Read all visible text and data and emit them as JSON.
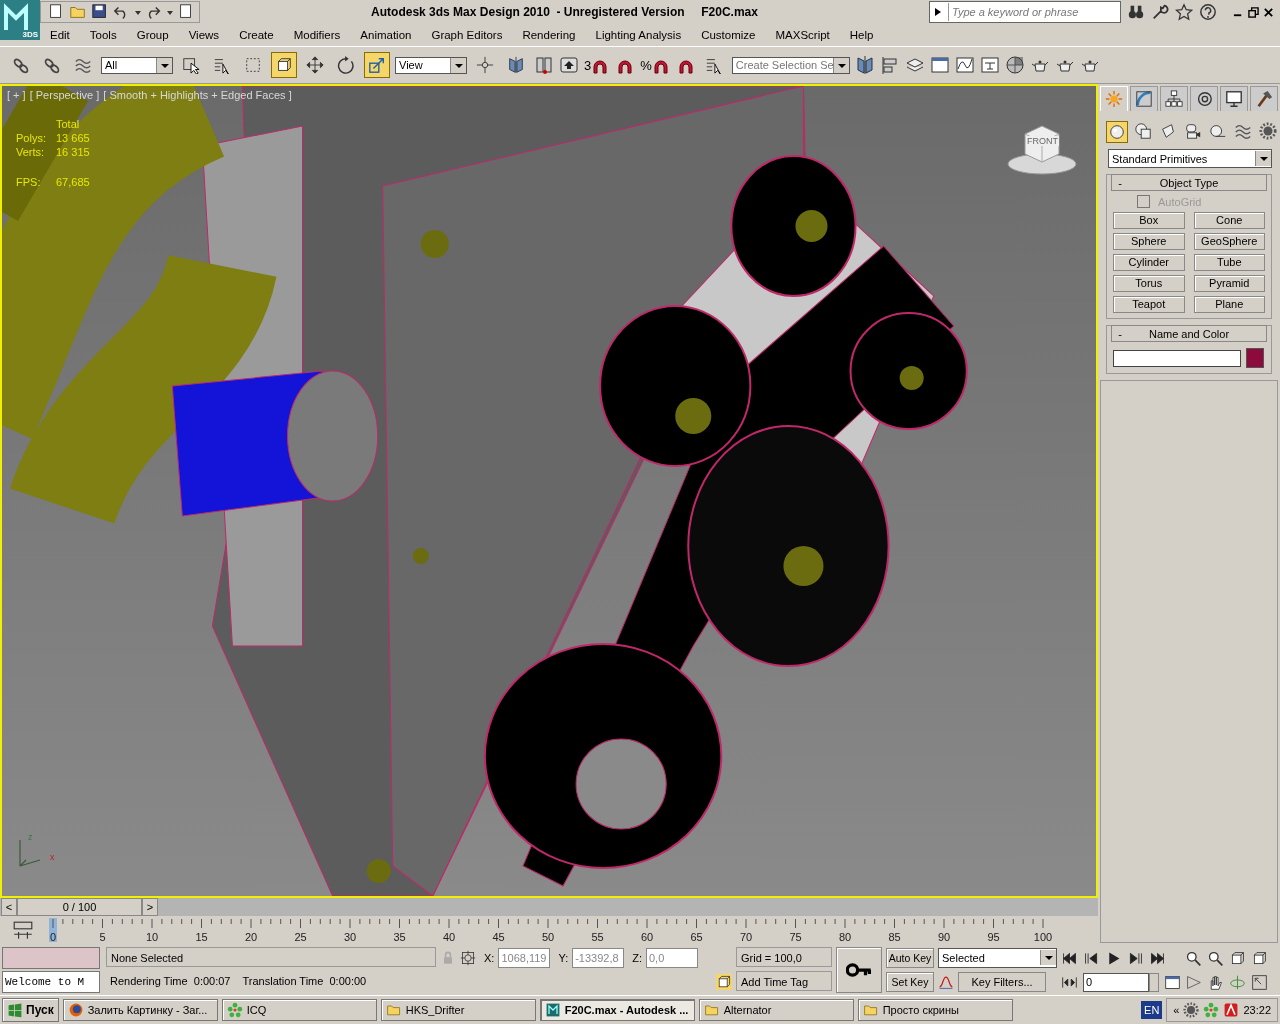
{
  "title_bar": {
    "logo_label": "3DS",
    "title": "Autodesk 3ds Max Design 2010  - Unregistered Version     F20C.max",
    "search_placeholder": "Type a keyword or phrase"
  },
  "menu": [
    "Edit",
    "Tools",
    "Group",
    "Views",
    "Create",
    "Modifiers",
    "Animation",
    "Graph Editors",
    "Rendering",
    "Lighting Analysis",
    "Customize",
    "MAXScript",
    "Help"
  ],
  "toolbar": {
    "selection_filter": "All",
    "reference_coordinate": "View",
    "snap_label": "3",
    "percent_label": "%",
    "named_selection_placeholder": "Create Selection Se",
    "tool_buttons": [
      {
        "selected": false
      },
      {
        "selected": false
      },
      {
        "selected": false
      },
      {
        "selected": true
      },
      {
        "selected": false
      },
      {
        "selected": false
      },
      {
        "selected": true
      },
      {
        "selected": false
      },
      {
        "selected": false
      },
      {
        "selected": false
      }
    ]
  },
  "viewport": {
    "active": true,
    "labels": [
      "[ + ]",
      "[ Perspective ]",
      "[ Smooth + Highlights + Edged Faces ]"
    ],
    "stats_header": "Total",
    "stats": [
      {
        "label": "Polys:",
        "value": "13 665"
      },
      {
        "label": "Verts:",
        "value": "16 315"
      }
    ],
    "fps": {
      "label": "FPS:",
      "value": "67,685"
    },
    "viewcube_label": "FRONT",
    "axis_labels": [
      "z",
      "x"
    ]
  },
  "command_panel": {
    "tabs": [
      {
        "selected": true
      },
      {
        "selected": false
      },
      {
        "selected": false
      },
      {
        "selected": false
      },
      {
        "selected": false
      },
      {
        "selected": false
      }
    ],
    "categories": [
      {
        "selected": true
      },
      {
        "selected": false
      },
      {
        "selected": false
      },
      {
        "selected": false
      },
      {
        "selected": false
      },
      {
        "selected": false
      },
      {
        "selected": false
      }
    ],
    "dropdown": "Standard Primitives",
    "object_type": {
      "collapse": "-",
      "title": "Object Type",
      "autogrid": {
        "label": "AutoGrid",
        "checked": false,
        "disabled": true
      },
      "buttons": [
        "Box",
        "Cone",
        "Sphere",
        "GeoSphere",
        "Cylinder",
        "Tube",
        "Torus",
        "Pyramid",
        "Teapot",
        "Plane"
      ]
    },
    "name_and_color": {
      "collapse": "-",
      "title": "Name and Color",
      "color": "#8c0a3c"
    }
  },
  "time_slider": {
    "prev": "<",
    "frame": "0 / 100",
    "next": ">"
  },
  "track_bar": {
    "labels": [
      "0",
      "5",
      "10",
      "15",
      "20",
      "25",
      "30",
      "35",
      "40",
      "45",
      "50",
      "55",
      "60",
      "65",
      "70",
      "75",
      "80",
      "85",
      "90",
      "95",
      "100"
    ]
  },
  "status": {
    "listener": "Welcome to M",
    "selection": "None Selected",
    "prompt": "Rendering Time  0:00:07    Translation Time  0:00:00",
    "coords": [
      {
        "label": "X:",
        "value": "1068,119"
      },
      {
        "label": "Y:",
        "value": "-13392,8"
      },
      {
        "label": "Z:",
        "value": "0,0"
      }
    ],
    "grid": "Grid = 100,0",
    "time_tag": "Add Time Tag",
    "auto_key": "Auto Key",
    "set_key": "Set Key",
    "key_mode": "Selected",
    "key_filters": "Key Filters...",
    "current_frame": "0"
  },
  "taskbar": {
    "start": "Пуск",
    "tasks": [
      {
        "kind": "browser",
        "label": "Залить Картинку - Заг...",
        "selected": false
      },
      {
        "kind": "flower",
        "label": "ICQ",
        "selected": false
      },
      {
        "kind": "folder",
        "label": "HKS_Drifter",
        "selected": false
      },
      {
        "kind": "app",
        "label": "F20C.max - Autodesk ...",
        "selected": true
      },
      {
        "kind": "folder",
        "label": "Alternator",
        "selected": false
      },
      {
        "kind": "folder",
        "label": "Просто скрины",
        "selected": false
      }
    ],
    "tray_expand": "«",
    "language": "EN",
    "clock": "23:22"
  }
}
